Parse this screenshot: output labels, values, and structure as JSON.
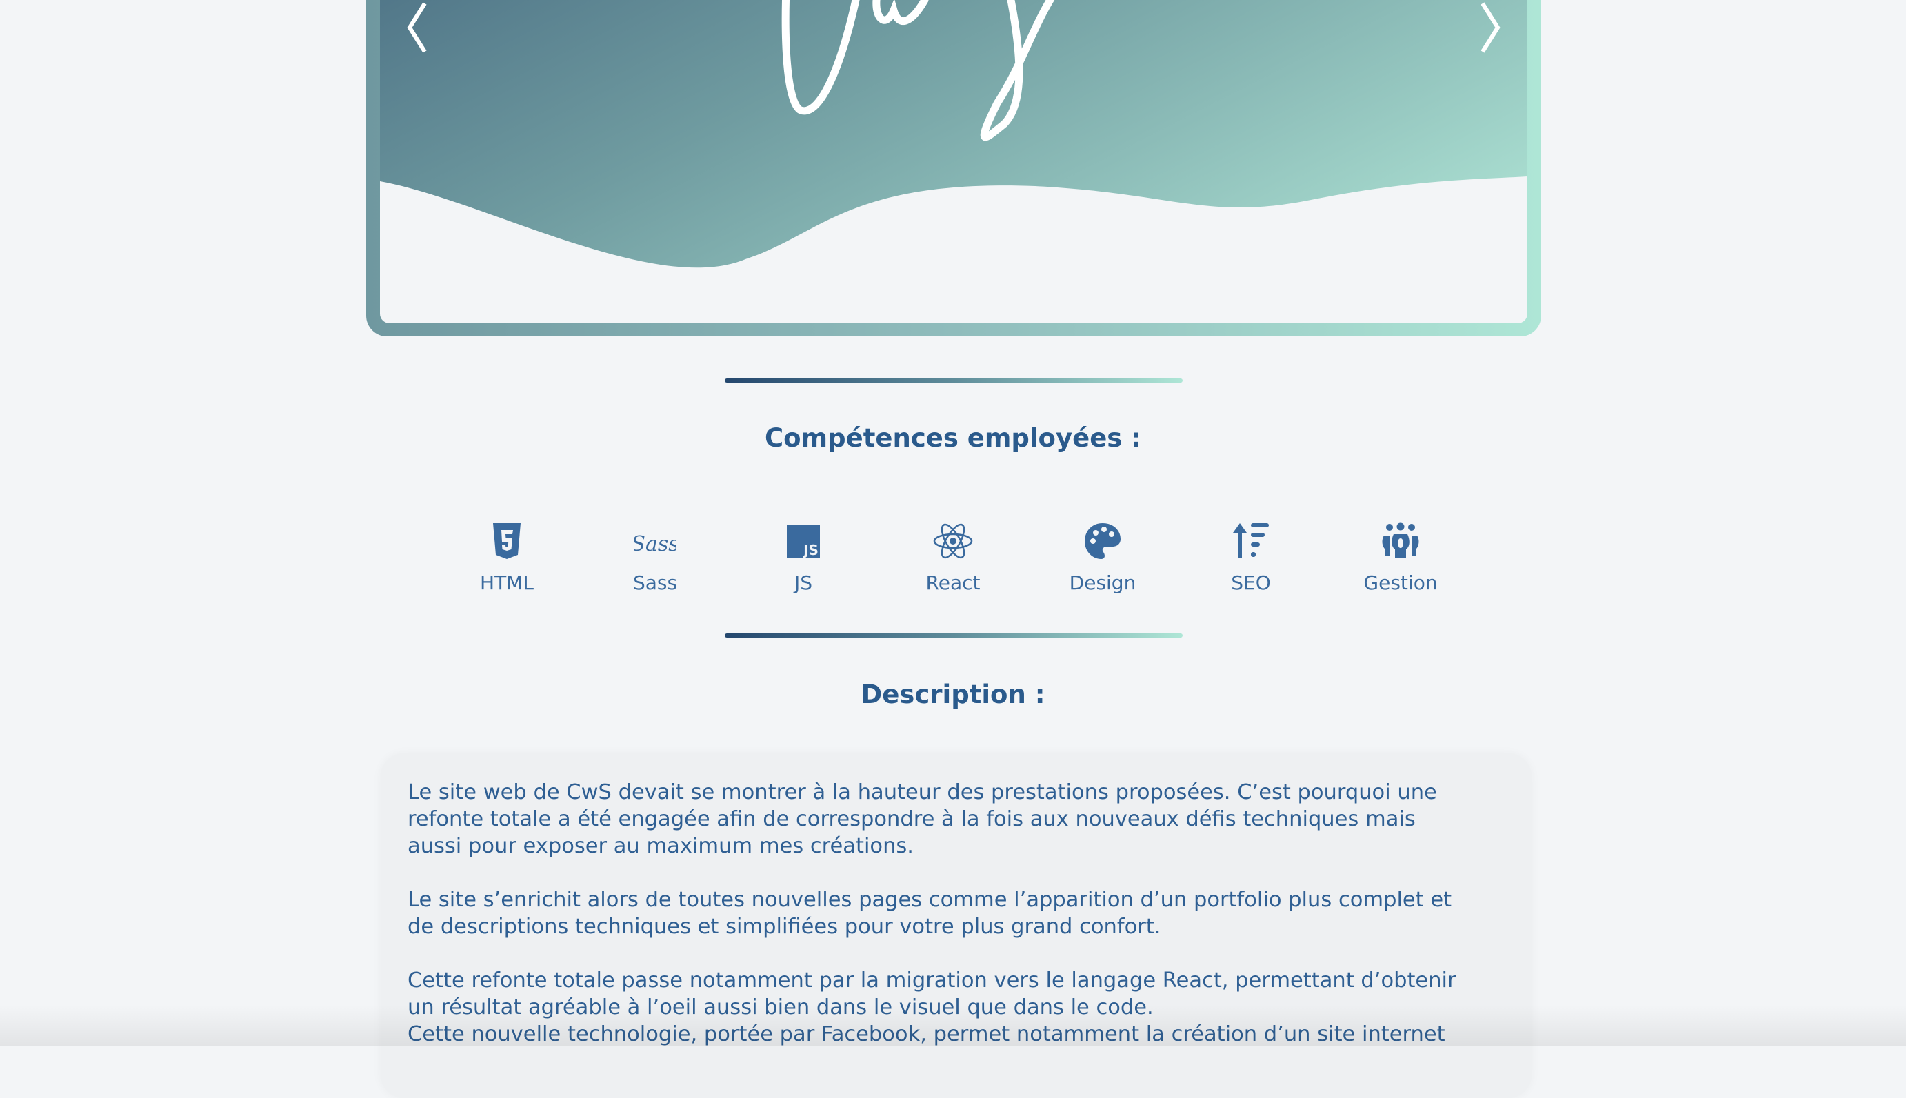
{
  "carousel": {
    "prev_icon": "chevron-left-icon",
    "next_icon": "chevron-right-icon",
    "gradient_colors": [
      "#4f7487",
      "#a8dccf"
    ],
    "frame_colors": [
      "#6f98a0",
      "#aee6d6"
    ]
  },
  "skills_section": {
    "title": "Compétences employées :",
    "items": [
      {
        "label": "HTML",
        "icon": "html5-icon"
      },
      {
        "label": "Sass",
        "icon": "sass-icon"
      },
      {
        "label": "JS",
        "icon": "js-icon"
      },
      {
        "label": "React",
        "icon": "react-icon"
      },
      {
        "label": "Design",
        "icon": "palette-icon"
      },
      {
        "label": "SEO",
        "icon": "sort-up-icon"
      },
      {
        "label": "Gestion",
        "icon": "people-group-icon"
      }
    ]
  },
  "description_section": {
    "title": "Description :",
    "paragraphs": [
      [
        "Le site web de CwS devait se montrer à la hauteur des prestations proposées. C’est pourquoi une",
        "refonte totale a été engagée afin de correspondre à la fois aux nouveaux défis techniques mais",
        "aussi pour exposer au maximum mes créations."
      ],
      [
        "Le site s’enrichit alors de toutes nouvelles pages comme l’apparition d’un portfolio plus complet et",
        "de descriptions techniques et simplifiées pour votre plus grand confort."
      ],
      [
        "Cette refonte totale passe notamment par la migration vers le langage React, permettant d’obtenir",
        "un résultat agréable à l’oeil aussi bien dans le visuel que dans le code.",
        "Cette nouvelle technologie, portée par Facebook, permet notamment la création d’un site internet"
      ]
    ]
  },
  "colors": {
    "accent": "#2a5a8c",
    "icon": "#3a6a9e",
    "background": "#f3f5f7"
  }
}
